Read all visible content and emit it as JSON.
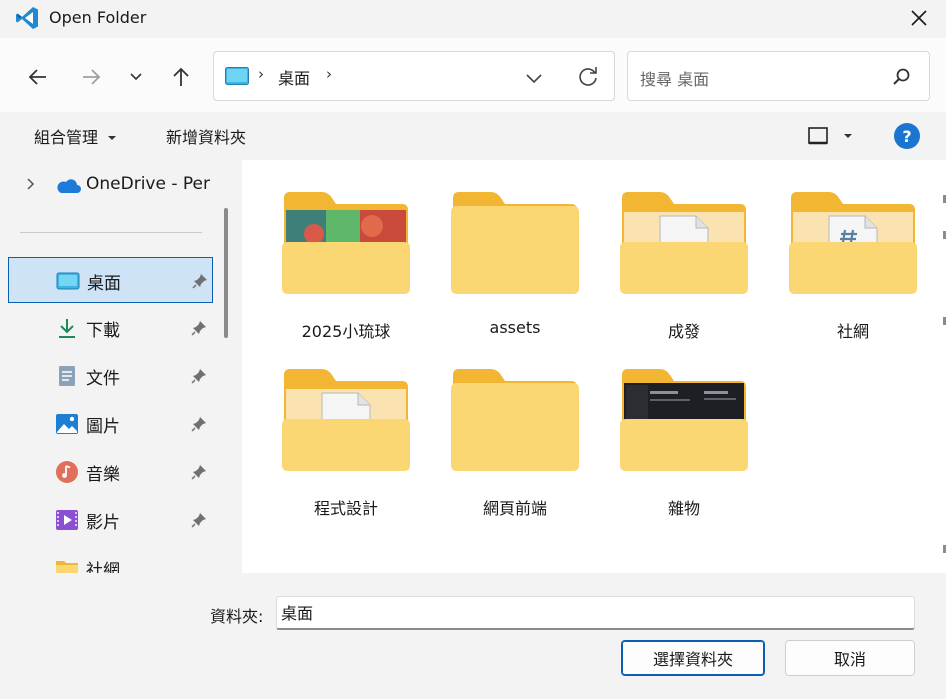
{
  "window": {
    "title": "Open Folder"
  },
  "address": {
    "path": "桌面"
  },
  "search": {
    "placeholder": "搜尋 桌面"
  },
  "toolbar": {
    "organize": "組合管理",
    "new_folder": "新增資料夾",
    "help": "?"
  },
  "sidebar": {
    "onedrive": "OneDrive - Per",
    "items": [
      {
        "label": "桌面",
        "icon": "desktop-icon",
        "selected": true
      },
      {
        "label": "下載",
        "icon": "download-icon"
      },
      {
        "label": "文件",
        "icon": "documents-icon"
      },
      {
        "label": "圖片",
        "icon": "pictures-icon"
      },
      {
        "label": "音樂",
        "icon": "music-icon"
      },
      {
        "label": "影片",
        "icon": "videos-icon"
      },
      {
        "label": "社網",
        "icon": "folder-icon"
      }
    ]
  },
  "folders": [
    {
      "name": "2025小琉球",
      "thumb": "photo"
    },
    {
      "name": "assets",
      "thumb": "plain"
    },
    {
      "name": "成發",
      "thumb": "doc"
    },
    {
      "name": "社網",
      "thumb": "doc-hash"
    },
    {
      "name": "程式設計",
      "thumb": "doc"
    },
    {
      "name": "網頁前端",
      "thumb": "plain"
    },
    {
      "name": "雜物",
      "thumb": "screenshot"
    }
  ],
  "footer": {
    "folder_label": "資料夾:",
    "folder_value": "桌面",
    "select_button": "選擇資料夾",
    "cancel_button": "取消"
  },
  "colors": {
    "accent": "#0a5fb4",
    "folder_back": "#f2b632",
    "folder_front": "#fbd774"
  }
}
